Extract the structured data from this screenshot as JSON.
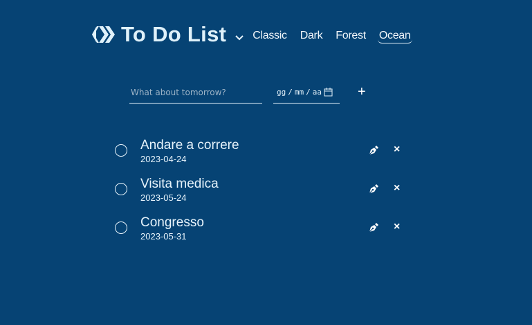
{
  "header": {
    "title": "To Do List",
    "themes": [
      "Classic",
      "Dark",
      "Forest",
      "Ocean"
    ],
    "active_theme": "Ocean"
  },
  "form": {
    "placeholder": "What about tomorrow?",
    "date_placeholder": {
      "day": "gg",
      "month": "mm",
      "year": "aa"
    },
    "add_label": "+"
  },
  "todos": [
    {
      "name": "Andare a correre",
      "date": "2023-04-24"
    },
    {
      "name": "Visita medica",
      "date": "2023-05-24"
    },
    {
      "name": "Congresso",
      "date": "2023-05-31"
    }
  ],
  "delete_label": "×",
  "colors": {
    "background": "#064374",
    "text": "#e6f3fb"
  }
}
